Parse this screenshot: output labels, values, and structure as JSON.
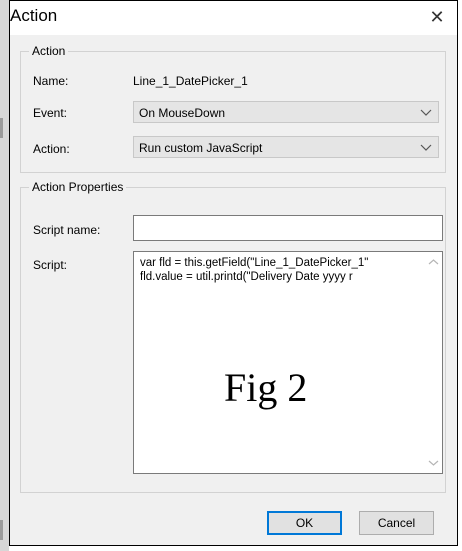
{
  "window": {
    "title": "Action",
    "close_glyph": "✕"
  },
  "action_group": {
    "legend": "Action",
    "name_label": "Name:",
    "name_value": "Line_1_DatePicker_1",
    "event_label": "Event:",
    "event_value": "On MouseDown",
    "action_label": "Action:",
    "action_value": "Run custom JavaScript"
  },
  "properties_group": {
    "legend": "Action Properties",
    "script_name_label": "Script name:",
    "script_name_value": "",
    "script_label": "Script:",
    "script_lines": [
      "var fld = this.getField(\"Line_1_DatePicker_1\"",
      "fld.value = util.printd(\"Delivery Date    yyyy r"
    ],
    "overlay_caption": "Fig 2"
  },
  "buttons": {
    "ok_label": "OK",
    "cancel_label": "Cancel"
  },
  "icons": {
    "close": "close-icon",
    "dropdown": "chevron-down-icon",
    "scroll_up": "scroll-up-arrow-icon",
    "scroll_down": "scroll-down-arrow-icon"
  },
  "colors": {
    "dialog_bg": "#f0f0f0",
    "combo_bg": "#e5e5e5",
    "accent": "#0078d7"
  }
}
